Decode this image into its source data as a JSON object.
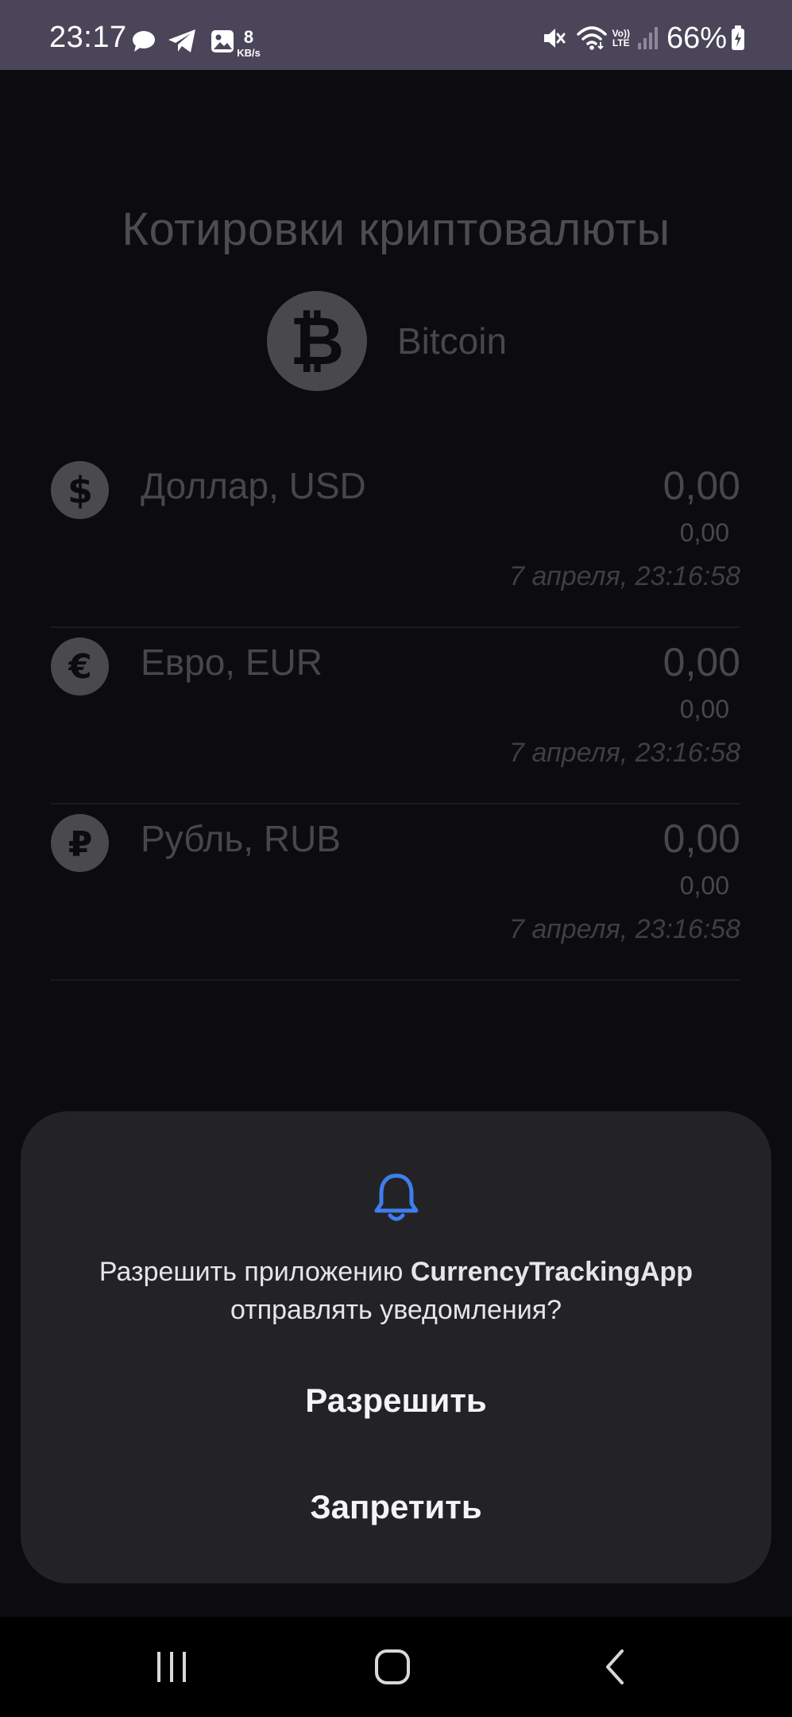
{
  "status_bar": {
    "time": "23:17",
    "net_speed_value": "8",
    "net_speed_unit": "KB/s",
    "volte_top": "Vo))",
    "volte_bottom": "LTE",
    "battery": "66%",
    "icons": [
      "chat-bubble-icon",
      "telegram-icon",
      "gallery-icon",
      "mute-icon",
      "wifi-icon",
      "signal-icon",
      "battery-icon"
    ]
  },
  "app": {
    "title": "Котировки криптовалюты",
    "crypto": {
      "name": "Bitcoin",
      "icon": "bitcoin-icon"
    },
    "currencies": [
      {
        "name": "Доллар, USD",
        "icon": "dollar-icon",
        "value": "0,00",
        "change": "0,00",
        "updated": "7 апреля, 23:16:58"
      },
      {
        "name": "Евро, EUR",
        "icon": "euro-icon",
        "value": "0,00",
        "change": "0,00",
        "updated": "7 апреля, 23:16:58"
      },
      {
        "name": "Рубль, RUB",
        "icon": "ruble-icon",
        "value": "0,00",
        "change": "0,00",
        "updated": "7 апреля, 23:16:58"
      }
    ]
  },
  "dialog": {
    "icon": "bell-icon",
    "message_prefix": "Разрешить приложению ",
    "app_name": "CurrencyTrackingApp",
    "message_suffix": "отправлять уведомления?",
    "allow_label": "Разрешить",
    "deny_label": "Запретить"
  },
  "nav_bar": {
    "buttons": [
      "recent-apps-icon",
      "home-icon",
      "back-icon"
    ]
  },
  "colors": {
    "status_bar_bg": "#4a4559",
    "background": "#0c0c0e",
    "dialog_bg": "#232325",
    "bell_accent": "#3f7df0"
  }
}
